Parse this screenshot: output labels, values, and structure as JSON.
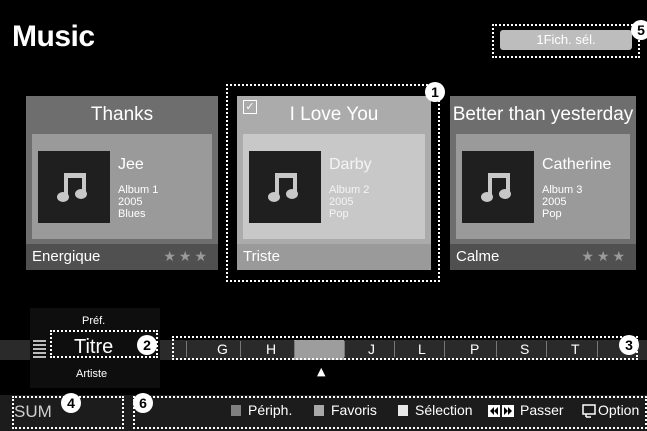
{
  "header": {
    "title": "Music",
    "selection_count": "1Fich. sél."
  },
  "cards": [
    {
      "title": "Thanks",
      "artist": "Jee",
      "album": "Album 1",
      "year": "2005",
      "genre": "Blues",
      "mood": "Energique",
      "checked": false
    },
    {
      "title": "I Love You",
      "artist": "Darby",
      "album": "Album 2",
      "year": "2005",
      "genre": "Pop",
      "mood": "Triste",
      "checked": true
    },
    {
      "title": "Better than yesterday",
      "artist": "Catherine",
      "album": "Album 3",
      "year": "2005",
      "genre": "Pop",
      "mood": "Calme",
      "checked": false
    }
  ],
  "rating_glyph": "★★★",
  "checkbox_glyph": "✓",
  "sort": {
    "previous": "Préf.",
    "current": "Titre",
    "next": "Artiste"
  },
  "index_letters": [
    "G",
    "H",
    "J",
    "L",
    "P",
    "S",
    "T"
  ],
  "index_marker": "▲",
  "footer": {
    "mode": "SUM",
    "legend": [
      {
        "key": "a",
        "label": "Périph.",
        "color": "#808080"
      },
      {
        "key": "b",
        "label": "Favoris",
        "color": "#a8a8a8"
      },
      {
        "key": "c",
        "label": "Sélection",
        "color": "#e8e8e8"
      }
    ],
    "passer_label": "Passer",
    "option_label": "Option"
  },
  "callouts": [
    "1",
    "2",
    "3",
    "4",
    "5",
    "6"
  ]
}
